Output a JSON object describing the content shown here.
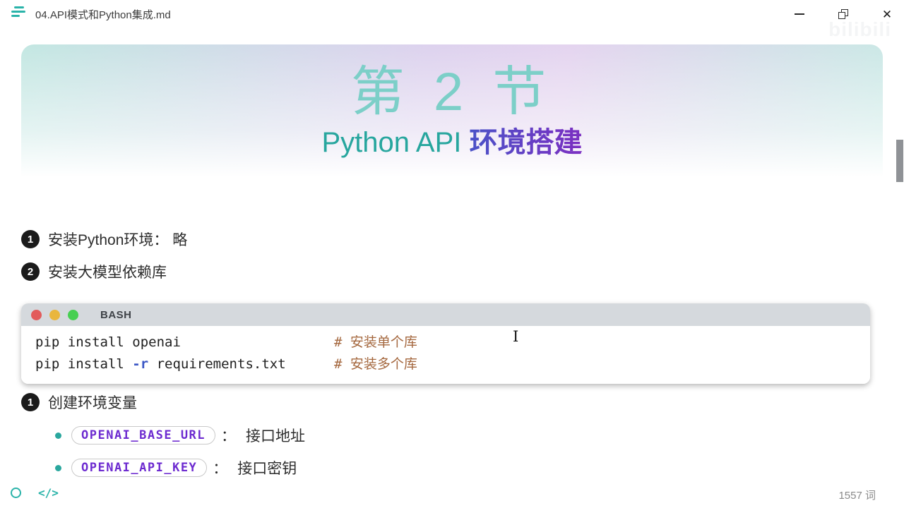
{
  "window": {
    "title": "04.API模式和Python集成.md",
    "watermark": "bilibili"
  },
  "hero": {
    "line1": "第 2 节",
    "subtitle_en": "Python API ",
    "subtitle_zh": "环境搭建"
  },
  "steps_top": [
    {
      "num": "1",
      "text": "安装Python环境： 略"
    },
    {
      "num": "2",
      "text": "安装大模型依赖库"
    }
  ],
  "code_block": {
    "lang": "BASH",
    "lines": [
      {
        "pre": "pip install openai",
        "flag": "",
        "post": "",
        "comment": "# 安装单个库"
      },
      {
        "pre": "pip install ",
        "flag": "-r",
        "post": " requirements.txt",
        "comment": "# 安装多个库"
      }
    ]
  },
  "steps_bottom": [
    {
      "num": "1",
      "text": "创建环境变量"
    }
  ],
  "env_vars": [
    {
      "code": "OPENAI_BASE_URL",
      "sep": "：",
      "desc": "接口地址"
    },
    {
      "code": "OPENAI_API_KEY",
      "sep": "：",
      "desc": "接口密钥"
    }
  ],
  "footer": {
    "word_count": "1557 词"
  },
  "colors": {
    "accent_teal": "#2ab3a9",
    "hero_teal": "#7ccfc8",
    "subtitle_teal": "#27a69e",
    "subtitle_purple": "#7c2fc2",
    "pill_purple": "#6d2bd0",
    "comment_brown": "#a5683f",
    "flag_blue": "#3a56c5",
    "code_header_gray": "#d5d9dd",
    "traffic_red": "#e25b5b",
    "traffic_yellow": "#e9b63e",
    "traffic_green": "#47cf51"
  }
}
